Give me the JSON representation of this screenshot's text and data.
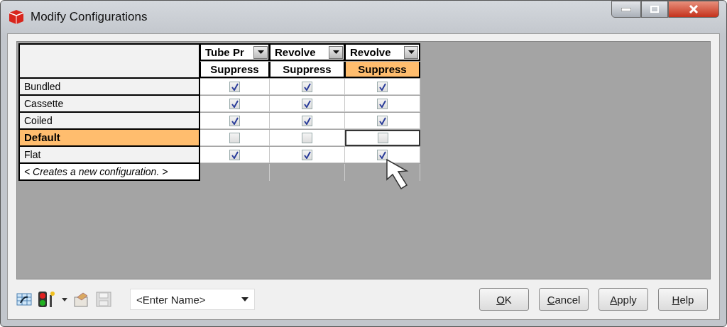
{
  "window": {
    "title": "Modify Configurations"
  },
  "table": {
    "columns": [
      {
        "title": "Tube Pr",
        "subtitle": "Suppress",
        "selected": false
      },
      {
        "title": "Revolve",
        "subtitle": "Suppress",
        "selected": false
      },
      {
        "title": "Revolve",
        "subtitle": "Suppress",
        "selected": true
      }
    ],
    "rows": [
      {
        "name": "Bundled",
        "selected": false,
        "cells": [
          {
            "checked": true,
            "focused": false
          },
          {
            "checked": true,
            "focused": false
          },
          {
            "checked": true,
            "focused": false
          }
        ]
      },
      {
        "name": "Cassette",
        "selected": false,
        "cells": [
          {
            "checked": true,
            "focused": false
          },
          {
            "checked": true,
            "focused": false
          },
          {
            "checked": true,
            "focused": false
          }
        ]
      },
      {
        "name": "Coiled",
        "selected": false,
        "cells": [
          {
            "checked": true,
            "focused": false
          },
          {
            "checked": true,
            "focused": false
          },
          {
            "checked": true,
            "focused": false
          }
        ]
      },
      {
        "name": "Default",
        "selected": true,
        "cells": [
          {
            "checked": false,
            "focused": false
          },
          {
            "checked": false,
            "focused": false
          },
          {
            "checked": false,
            "focused": true
          }
        ]
      },
      {
        "name": "Flat",
        "selected": false,
        "cells": [
          {
            "checked": true,
            "focused": false
          },
          {
            "checked": true,
            "focused": false
          },
          {
            "checked": true,
            "focused": false
          }
        ]
      }
    ],
    "new_row": {
      "text": "< Creates a new configuration. >"
    }
  },
  "name_combo": {
    "value": "<Enter Name>"
  },
  "buttons": [
    {
      "accel": "O",
      "rest": "K"
    },
    {
      "accel": "C",
      "rest": "ancel"
    },
    {
      "accel": "A",
      "rest": "pply"
    },
    {
      "accel": "H",
      "rest": "elp"
    }
  ]
}
